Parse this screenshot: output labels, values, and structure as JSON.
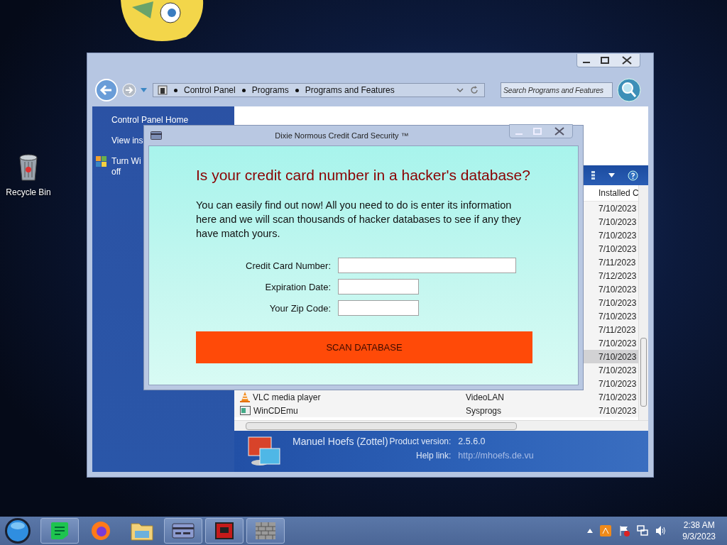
{
  "desktop": {
    "icons": [
      {
        "label": "Recycle Bin"
      }
    ]
  },
  "explorer": {
    "breadcrumb": [
      "Control Panel",
      "Programs",
      "Programs and Features"
    ],
    "search": {
      "placeholder": "Search Programs and Features"
    },
    "sidebar": {
      "items": [
        {
          "lines": [
            "Control Panel Home"
          ],
          "kind": "link"
        },
        {
          "lines": [
            "View ins"
          ],
          "kind": "link"
        },
        {
          "lines": [
            "Turn Wi",
            "off"
          ],
          "kind": "feature"
        }
      ]
    },
    "column_header": "Installed C",
    "rows": [
      {
        "date": "7/10/2023",
        "selected": false
      },
      {
        "date": "7/10/2023",
        "selected": false
      },
      {
        "date": "7/10/2023",
        "selected": false
      },
      {
        "date": "7/10/2023",
        "selected": false
      },
      {
        "date": "7/11/2023",
        "selected": false
      },
      {
        "date": "7/12/2023",
        "selected": false
      },
      {
        "date": "7/10/2023",
        "selected": false
      },
      {
        "date": "7/10/2023",
        "selected": false
      },
      {
        "date": "7/10/2023",
        "selected": false
      },
      {
        "date": "7/11/2023",
        "selected": false
      },
      {
        "date": "7/10/2023",
        "selected": false
      },
      {
        "date": "7/10/2023",
        "selected": true
      },
      {
        "date": "7/10/2023",
        "selected": false
      },
      {
        "date": "7/10/2023",
        "selected": false
      },
      {
        "name": "VLC media player",
        "publisher": "VideoLAN",
        "date": "7/10/2023",
        "kind": "cone",
        "selected": false
      },
      {
        "name": "WinCDEmu",
        "publisher": "Sysprogs",
        "date": "7/10/2023",
        "kind": "window",
        "selected": false
      }
    ],
    "details": {
      "name": "Manuel Hoefs (Zottel)",
      "fields": [
        {
          "label": "Product version:",
          "value": "2.5.6.0"
        },
        {
          "label": "Help link:",
          "value": "http://mhoefs.de.vu"
        }
      ]
    }
  },
  "dialog": {
    "title": "Dixie Normous Credit Card Security ™",
    "heading": "Is your credit card number in a hacker's database?",
    "message": "You can easily find out now! All you need to do is enter its information here and we will scan thousands of hacker databases to see if any they have match yours.",
    "fields": [
      {
        "label": "Credit Card Number:",
        "kind": "wide"
      },
      {
        "label": "Expiration Date:",
        "kind": "short"
      },
      {
        "label": "Your Zip Code:",
        "kind": "short"
      }
    ],
    "button": "SCAN DATABASE"
  },
  "taskbar": {
    "apps": [
      {
        "kind": "notes",
        "running": true
      },
      {
        "kind": "firefox",
        "running": false
      },
      {
        "kind": "folder",
        "running": false
      },
      {
        "kind": "card",
        "running": true
      },
      {
        "kind": "red",
        "running": true
      },
      {
        "kind": "wall",
        "running": true
      }
    ],
    "clock": {
      "time": "2:38 AM",
      "date": "9/3/2023"
    }
  }
}
